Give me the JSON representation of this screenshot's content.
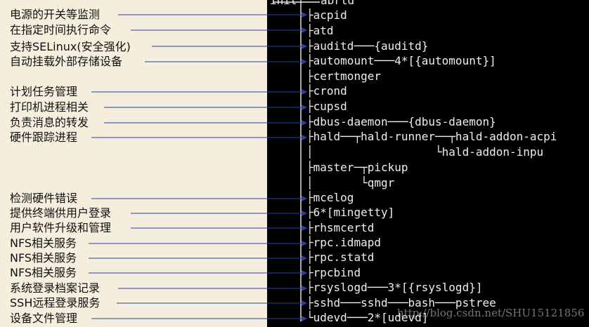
{
  "annotations": [
    {
      "label": "电源的开关等监测"
    },
    {
      "label": "在指定时间执行命令"
    },
    {
      "label": "支持SELinux(安全强化)"
    },
    {
      "label": "自动挂载外部存储设备"
    },
    {
      "label": "计划任务管理"
    },
    {
      "label": "打印机进程相关"
    },
    {
      "label": "负责消息的转发"
    },
    {
      "label": "硬件跟踪进程"
    },
    {
      "label": "检测硬件错误"
    },
    {
      "label": "提供终端供用户登录"
    },
    {
      "label": "用户软件升级和管理"
    },
    {
      "label": "NFS相关服务"
    },
    {
      "label": "NFS相关服务"
    },
    {
      "label": "NFS相关服务"
    },
    {
      "label": "系统登录档案记录"
    },
    {
      "label": "SSH远程登录服务"
    },
    {
      "label": "设备文件管理"
    }
  ],
  "terminal": {
    "root": "init",
    "top_partial": "abrtd",
    "lines": [
      {
        "text": "acpid"
      },
      {
        "text": "atd"
      },
      {
        "text": "auditd───{auditd}"
      },
      {
        "text": "automount───4*[{automount}]"
      },
      {
        "text": "certmonger"
      },
      {
        "text": "crond"
      },
      {
        "text": "cupsd"
      },
      {
        "text": "dbus-daemon───{dbus-daemon}"
      },
      {
        "text": "hald──┬hald-runner──┬hald-addon-acpi"
      },
      {
        "text": "                  └hald-addon-inpu"
      },
      {
        "text": "master─┬pickup"
      },
      {
        "text": "       └qmgr"
      },
      {
        "text": "mcelog"
      },
      {
        "text": "6*[mingetty]"
      },
      {
        "text": "rhsmcertd"
      },
      {
        "text": "rpc.idmapd"
      },
      {
        "text": "rpc.statd"
      },
      {
        "text": "rpcbind"
      },
      {
        "text": "rsyslogd───3*[{rsyslogd}]"
      },
      {
        "text": "sshd───sshd───bash───pstree"
      },
      {
        "text": "udevd───2*[udevd]"
      }
    ]
  },
  "watermark": "http://blog.csdn.net/SHU15121856",
  "colors": {
    "arrow": "#2a3fa8",
    "paper": "#f5eedd",
    "terminal_bg": "#000000",
    "terminal_fg": "#eeeeee"
  }
}
